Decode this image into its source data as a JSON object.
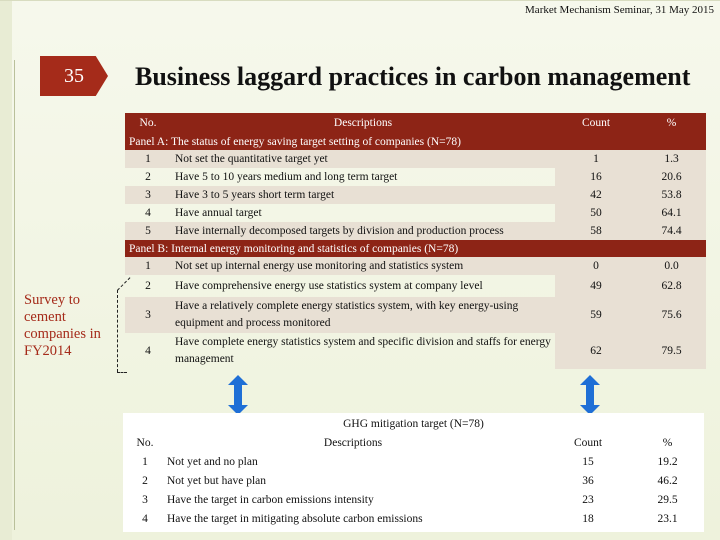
{
  "header": {
    "meta": "Market Mechanism Seminar, 31 May 2015",
    "slide_number": "35",
    "title": "Business laggard practices in carbon management"
  },
  "side_note": "Survey to cement companies in FY2014",
  "table1": {
    "columns": {
      "no": "No.",
      "desc": "Descriptions",
      "count": "Count",
      "pct": "%"
    },
    "panel_a": "Panel A: The status of energy saving target setting of companies (N=78)",
    "rows_a": [
      {
        "no": "1",
        "desc": "Not set the quantitative target yet",
        "count": "1",
        "pct": "1.3"
      },
      {
        "no": "2",
        "desc": "Have 5 to 10 years medium and long term target",
        "count": "16",
        "pct": "20.6"
      },
      {
        "no": "3",
        "desc": "Have 3 to 5 years short term target",
        "count": "42",
        "pct": "53.8"
      },
      {
        "no": "4",
        "desc": "Have annual target",
        "count": "50",
        "pct": "64.1"
      },
      {
        "no": "5",
        "desc": "Have internally decomposed targets by division and production process",
        "count": "58",
        "pct": "74.4"
      }
    ],
    "panel_b": "Panel B: Internal energy monitoring and statistics of companies (N=78)",
    "rows_b": [
      {
        "no": "1",
        "desc": "Not set up internal energy use monitoring and statistics system",
        "count": "0",
        "pct": "0.0"
      },
      {
        "no": "2",
        "desc": "Have comprehensive energy use statistics system at company level",
        "count": "49",
        "pct": "62.8"
      },
      {
        "no": "3",
        "desc": "Have a relatively complete energy statistics system, with key energy-using equipment and process monitored",
        "count": "59",
        "pct": "75.6"
      },
      {
        "no": "4",
        "desc": "Have complete energy statistics system and specific division and staffs for energy management",
        "count": "62",
        "pct": "79.5"
      }
    ]
  },
  "table2": {
    "title": "GHG mitigation target (N=78)",
    "columns": {
      "no": "No.",
      "desc": "Descriptions",
      "count": "Count",
      "pct": "%"
    },
    "rows": [
      {
        "no": "1",
        "desc": "Not yet and no plan",
        "count": "15",
        "pct": "19.2"
      },
      {
        "no": "2",
        "desc": "Not yet but have plan",
        "count": "36",
        "pct": "46.2"
      },
      {
        "no": "3",
        "desc": "Have the target in carbon emissions intensity",
        "count": "23",
        "pct": "29.5"
      },
      {
        "no": "4",
        "desc": "Have the target in mitigating absolute carbon emissions",
        "count": "18",
        "pct": "23.1"
      }
    ]
  },
  "colors": {
    "accent": "#8d2416",
    "arrow": "#1f6fd6"
  },
  "icons": {
    "arrows": "double-headed-vertical-arrow"
  }
}
